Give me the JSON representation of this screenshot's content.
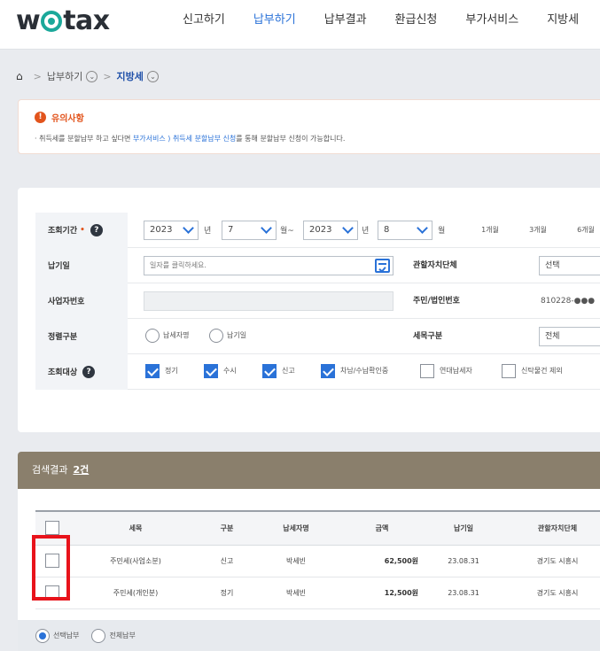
{
  "header": {
    "logo": {
      "prefix": "w",
      "suffix": "tax"
    },
    "nav": [
      "신고하기",
      "납부하기",
      "납부결과",
      "환급신청",
      "부가서비스",
      "지방세"
    ],
    "active_index": 1
  },
  "breadcrumb": {
    "level1": "납부하기",
    "level2": "지방세"
  },
  "notice": {
    "title": "유의사항",
    "text_before": "· 취득세를 분할납부 하고 싶다면 ",
    "link": "부가서비스 ) 취득세 분할납부 신청",
    "text_after": "를 통해 분할납부 신청이 가능합니다."
  },
  "search": {
    "period": {
      "label": "조회기간",
      "required_mark": "•",
      "from_year": "2023",
      "year_unit": "년",
      "from_month": "7",
      "month_unit": "월",
      "tilde": "~",
      "to_year": "2023",
      "to_month": "8",
      "buttons": [
        "1개월",
        "3개월",
        "6개월"
      ]
    },
    "due_date": {
      "label": "납기일",
      "placeholder": "일자를 클릭하세요."
    },
    "jurisdiction": {
      "label": "관할자치단체",
      "value": "선택"
    },
    "bizno": {
      "label": "사업자번호"
    },
    "resident_no": {
      "label": "주민/법인번호",
      "value": "810228-●●●"
    },
    "type": {
      "label": "정렬구분",
      "options": [
        "납세자명",
        "납기일"
      ]
    },
    "tax_type": {
      "label": "세목구분",
      "value": "전체"
    },
    "target": {
      "label": "조회대상",
      "options": [
        {
          "label": "정기",
          "checked": true
        },
        {
          "label": "수시",
          "checked": true
        },
        {
          "label": "신고",
          "checked": true
        },
        {
          "label": "차남/수납확인중",
          "checked": true
        },
        {
          "label": "연대납세자",
          "checked": false
        },
        {
          "label": "신탁물건 제외",
          "checked": false
        }
      ]
    }
  },
  "results": {
    "title": "검색결과",
    "count": "2건",
    "columns": [
      "세목",
      "구분",
      "납세자명",
      "금액",
      "납기일",
      "관할자치단체"
    ],
    "rows": [
      {
        "tax": "주민세(사업소분)",
        "kind": "신고",
        "payer": "박세빈",
        "amount": "62,500원",
        "due": "23.08.31",
        "region": "경기도 시흥시"
      },
      {
        "tax": "주민세(개인분)",
        "kind": "정기",
        "payer": "박세빈",
        "amount": "12,500원",
        "due": "23.08.31",
        "region": "경기도 시흥시"
      }
    ]
  },
  "footer": {
    "options": [
      "선택납부",
      "전체납부"
    ]
  },
  "colors": {
    "accent": "#2a72d8",
    "logo_green": "#1ba89a",
    "results_header": "#8a7f6c",
    "highlight": "#e8131b",
    "notice": "#e2541c"
  }
}
